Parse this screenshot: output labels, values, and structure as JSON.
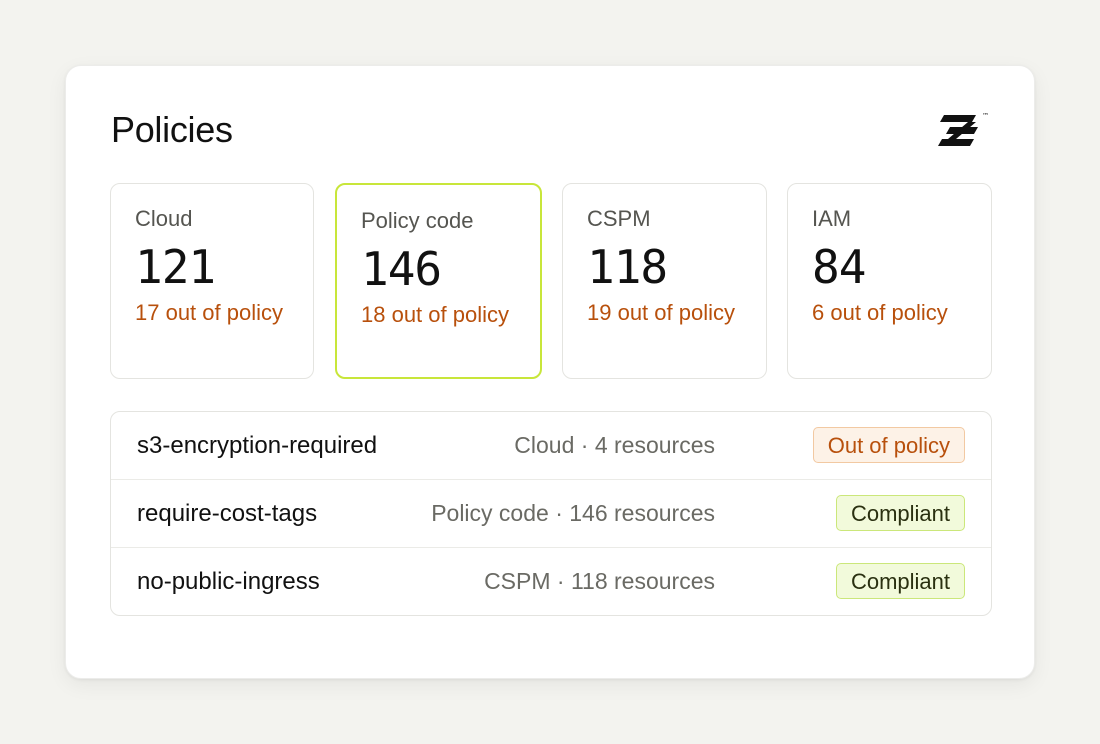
{
  "header": {
    "title": "Policies",
    "logo_icon": "brand-logo-icon",
    "logo_mark": "™"
  },
  "stats": [
    {
      "label": "Cloud",
      "value": "121",
      "sub": "17 out of policy",
      "selected": false
    },
    {
      "label": "Policy code",
      "value": "146",
      "sub": "18 out of policy",
      "selected": true
    },
    {
      "label": "CSPM",
      "value": "118",
      "sub": "19 out of policy",
      "selected": false
    },
    {
      "label": "IAM",
      "value": "84",
      "sub": "6 out of policy",
      "selected": false
    }
  ],
  "policies": [
    {
      "name": "s3-encryption-required",
      "meta": "Cloud · 4 resources",
      "status": "Out of policy"
    },
    {
      "name": "require-cost-tags",
      "meta": "Policy code · 146 resources",
      "status": "Compliant"
    },
    {
      "name": "no-public-ingress",
      "meta": "CSPM · 118 resources",
      "status": "Compliant"
    }
  ],
  "colors": {
    "accent_selected": "#c8e63a",
    "out_of_policy": "#b8500c",
    "compliant_bg": "#f2fadb"
  }
}
